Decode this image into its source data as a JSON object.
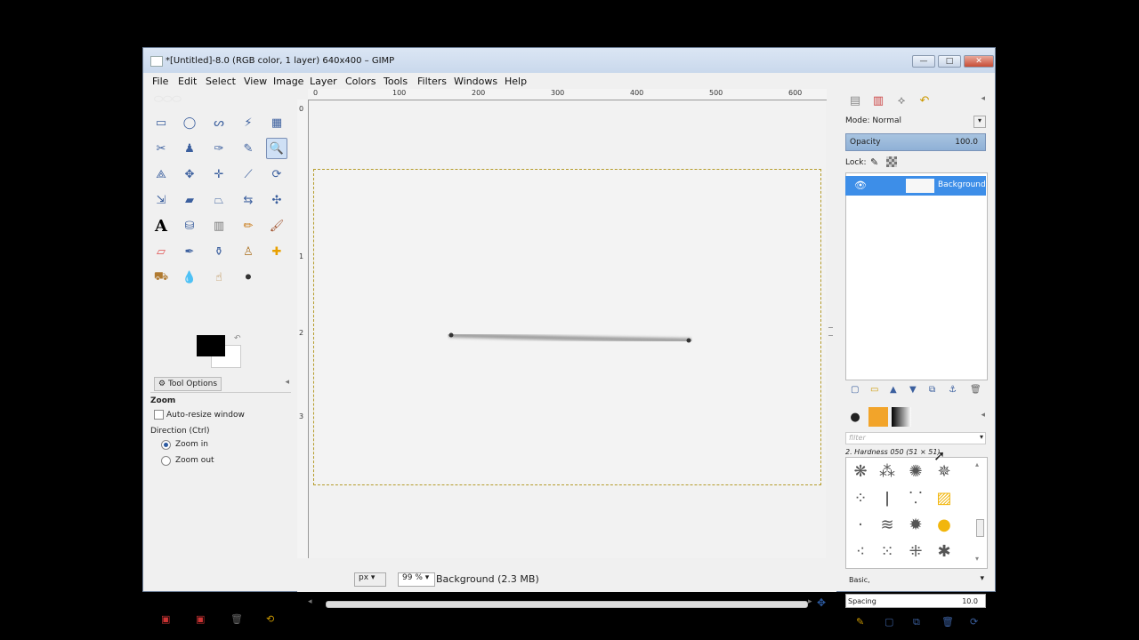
{
  "window": {
    "title": "*[Untitled]-8.0 (RGB color, 1 layer) 640x400 – GIMP",
    "minimize": "—",
    "maximize": "□",
    "close": "✕"
  },
  "menu": {
    "items": [
      "File",
      "Edit",
      "Select",
      "View",
      "Image",
      "Layer",
      "Colors",
      "Tools",
      "Filters",
      "Windows",
      "Help"
    ]
  },
  "ruler": {
    "h_labels": [
      "0",
      "100",
      "200",
      "300",
      "400",
      "500",
      "600"
    ],
    "v_labels": [
      "0",
      "1",
      "2",
      "3"
    ]
  },
  "tool_options": {
    "tab_label": "Tool Options",
    "tool_name": "Zoom",
    "auto_resize_label": "Auto-resize window",
    "direction_label": "Direction  (Ctrl)",
    "zoom_in_label": "Zoom in",
    "zoom_out_label": "Zoom out"
  },
  "status": {
    "unit": "px",
    "zoom": "99 %",
    "message": "Background (2.3 MB)"
  },
  "layers": {
    "mode_label": "Mode: Normal",
    "opacity_label": "Opacity",
    "opacity_value": "100.0",
    "lock_label": "Lock:",
    "layer_name": "Background"
  },
  "brushes": {
    "filter_placeholder": "filter",
    "current_brush": "2. Hardness 050 (51 × 51)",
    "tag_value": "Basic,",
    "spacing_label": "Spacing",
    "spacing_value": "10.0"
  },
  "colors": {
    "foreground": "#000000",
    "background": "#ffffff",
    "selection_accent": "#3d8ee8",
    "boundary": "#b59c2a"
  }
}
